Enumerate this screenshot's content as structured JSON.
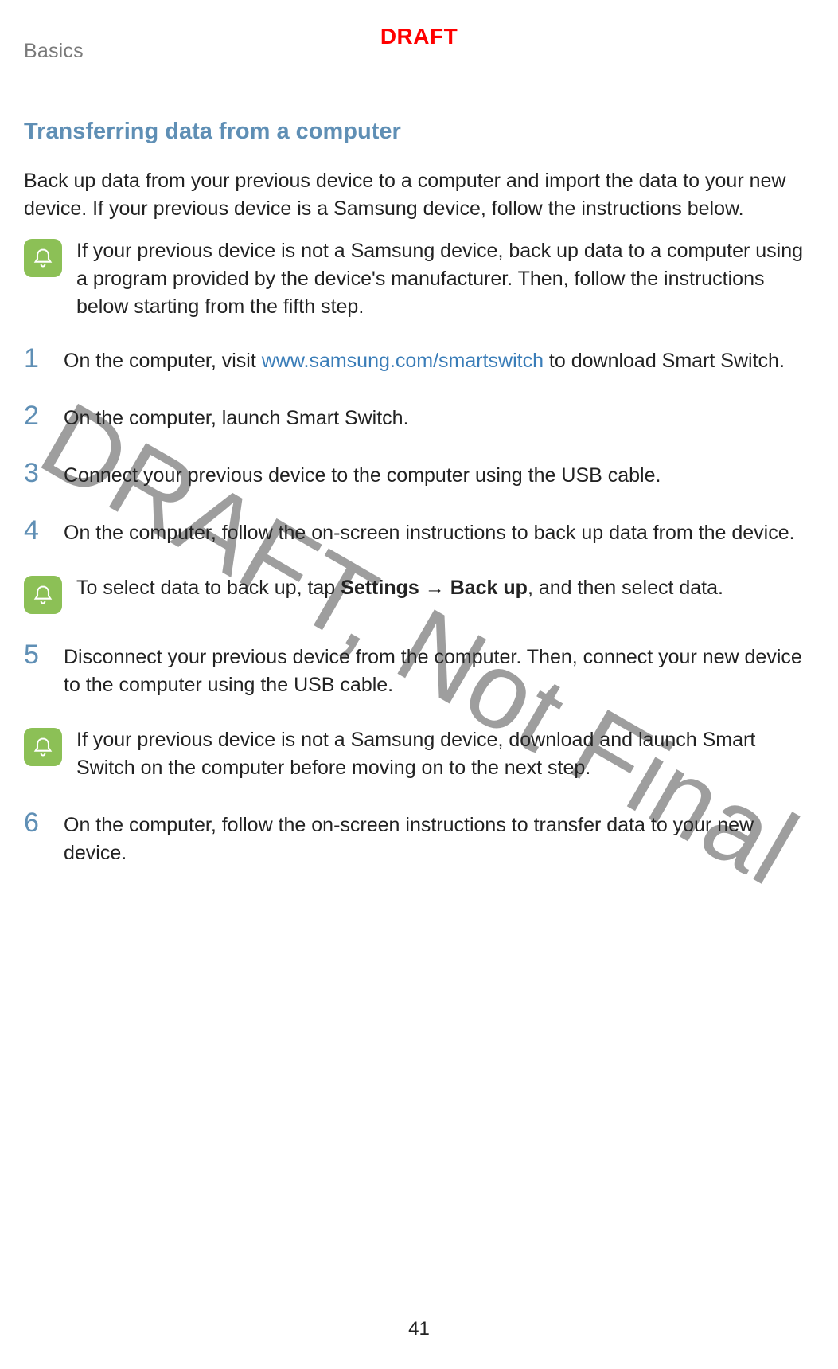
{
  "header": {
    "section": "Basics"
  },
  "stamps": {
    "draft_top": "DRAFT",
    "watermark": "DRAFT, Not Final"
  },
  "section": {
    "title": "Transferring data from a computer",
    "intro": "Back up data from your previous device to a computer and import the data to your new device. If your previous device is a Samsung device, follow the instructions below."
  },
  "notes": {
    "not_samsung_intro": "If your previous device is not a Samsung device, back up data to a computer using a program provided by the device's manufacturer. Then, follow the instructions below starting from the fifth step.",
    "select_data_prefix": "To select data to back up, tap ",
    "select_data_bold1": "Settings",
    "select_data_arrow": " → ",
    "select_data_bold2": "Back up",
    "select_data_suffix": ", and then select data.",
    "not_samsung_step5": "If your previous device is not a Samsung device, download and launch Smart Switch on the computer before moving on to the next step."
  },
  "steps": {
    "s1_prefix": "On the computer, visit ",
    "s1_link_text": "www.samsung.com/smartswitch",
    "s1_suffix": " to download Smart Switch.",
    "s2": "On the computer, launch Smart Switch.",
    "s3": "Connect your previous device to the computer using the USB cable.",
    "s4": "On the computer, follow the on-screen instructions to back up data from the device.",
    "s5": "Disconnect your previous device from the computer. Then, connect your new device to the computer using the USB cable.",
    "s6": "On the computer, follow the on-screen instructions to transfer data to your new device."
  },
  "step_numbers": {
    "n1": "1",
    "n2": "2",
    "n3": "3",
    "n4": "4",
    "n5": "5",
    "n6": "6"
  },
  "footer": {
    "page_number": "41"
  }
}
